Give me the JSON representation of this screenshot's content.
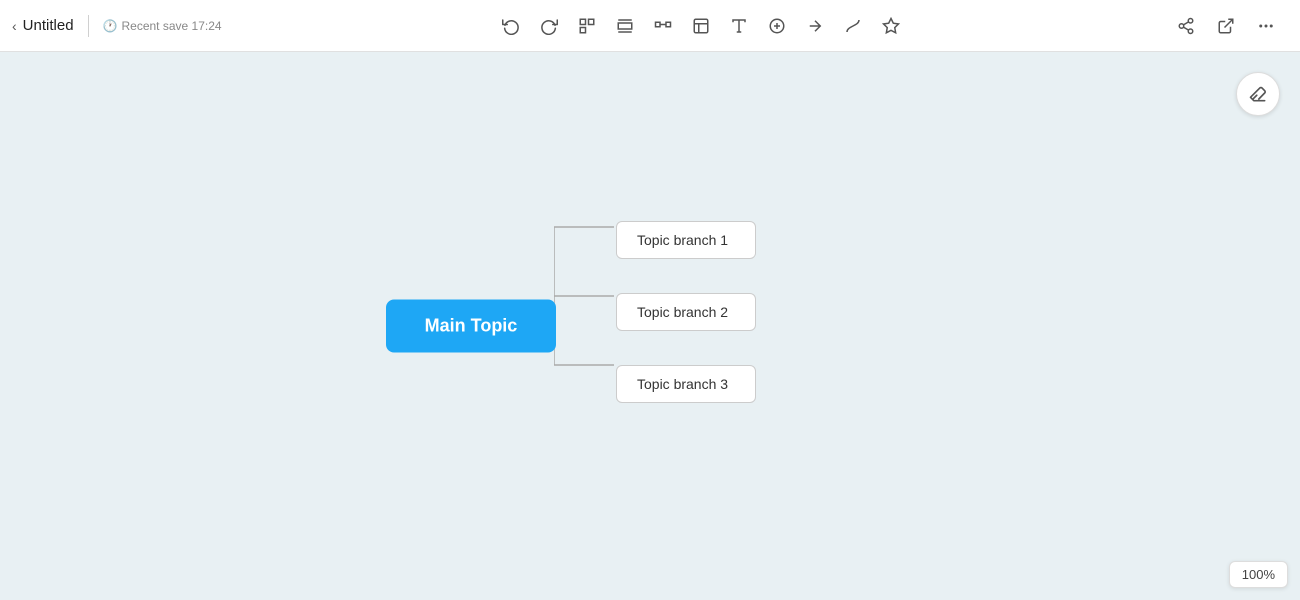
{
  "header": {
    "title": "Untitled",
    "back_label": "‹",
    "save_status": "Recent save 17:24",
    "clock_icon": "🕐"
  },
  "toolbar": {
    "undo_label": "↩",
    "redo_label": "↪",
    "btn1": "⊡",
    "btn2": "⊟",
    "btn3": "⊠",
    "btn4": "⊞",
    "btn5": "⊤",
    "btn6": "⊕",
    "btn7": "⇒",
    "btn8": "⌇",
    "btn9": "✳"
  },
  "right_actions": {
    "share_label": "⇧",
    "export_label": "⬡",
    "more_label": "⋯"
  },
  "canvas": {
    "background": "#e8f0f3",
    "eraser_icon": "✎",
    "zoom": "100%"
  },
  "mindmap": {
    "main_topic": "Main Topic",
    "branches": [
      {
        "id": "branch1",
        "label": "Topic branch 1"
      },
      {
        "id": "branch2",
        "label": "Topic branch 2"
      },
      {
        "id": "branch3",
        "label": "Topic branch 3"
      }
    ]
  }
}
